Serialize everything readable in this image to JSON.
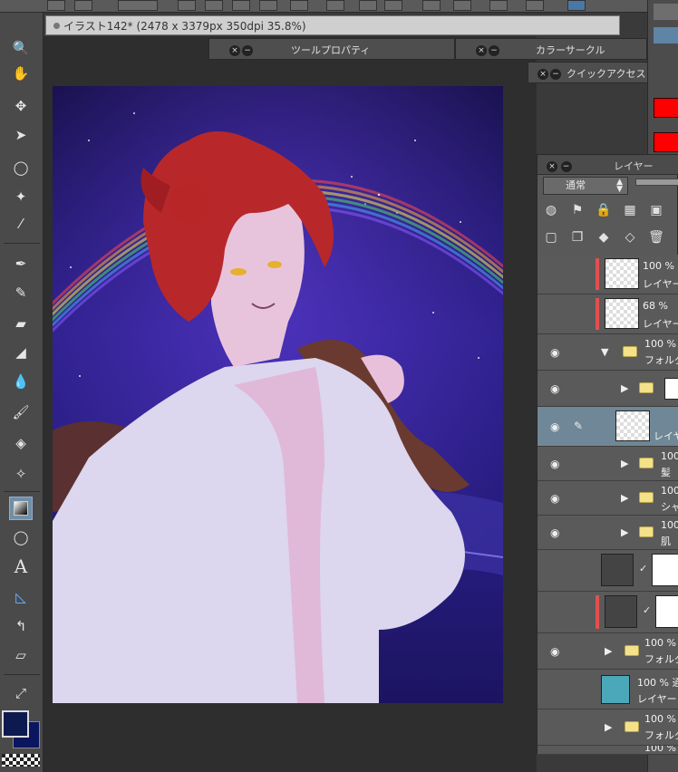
{
  "document": {
    "title": "イラスト142* (2478 x 3379px 350dpi 35.8%)"
  },
  "panels": {
    "tool_property": "ツールプロパティ",
    "color_circle": "カラーサークル",
    "quick_access": "クイックアクセス",
    "layer": "レイヤー"
  },
  "panel_buttons": {
    "close": "×",
    "minimize": "−"
  },
  "tools": [
    "zoom-tool",
    "hand-tool",
    "move-tool",
    "operation-tool",
    "lasso-tool",
    "magic-wand-tool",
    "eyedropper-tool",
    "pen-tool",
    "pencil-tool",
    "brush-tool",
    "eraser-tool",
    "blend-tool",
    "fill-tool",
    "gradient-tool",
    "figure-tool",
    "text-tool",
    "ruler-tool",
    "balloon-tool",
    "frame-tool",
    "correct-line-tool"
  ],
  "colors": {
    "main": "#0d1a50",
    "sub": "#0a1660",
    "accent": "#6f8fa6",
    "swatch_red": "#ff0000"
  },
  "layer_panel": {
    "blend_mode": "通常",
    "layers": [
      {
        "opacity": "100 %",
        "name": "レイヤー",
        "type": "raster",
        "visible": false,
        "red": true
      },
      {
        "opacity": "68 %",
        "name": "レイヤー",
        "type": "raster",
        "visible": false,
        "red": true
      },
      {
        "opacity": "100 %",
        "name": "フォルダー",
        "type": "folder",
        "visible": true,
        "expanded": true
      },
      {
        "opacity": "",
        "name": "",
        "type": "folder-sub",
        "visible": true
      },
      {
        "opacity": "",
        "name": "レイヤ",
        "type": "selected",
        "visible": true
      },
      {
        "opacity": "100",
        "name": "髪",
        "type": "folder-sub",
        "visible": true
      },
      {
        "opacity": "100",
        "name": "シャ",
        "type": "folder-sub",
        "visible": true
      },
      {
        "opacity": "100",
        "name": "肌",
        "type": "folder-sub",
        "visible": true
      },
      {
        "opacity": "",
        "name": "",
        "type": "mask",
        "visible": false
      },
      {
        "opacity": "",
        "name": "",
        "type": "mask",
        "visible": false,
        "red": true
      },
      {
        "opacity": "100 %",
        "name": "フォルダ",
        "type": "folder",
        "visible": true
      },
      {
        "opacity": "100 % 通",
        "name": "レイヤー",
        "type": "teal",
        "visible": false
      },
      {
        "opacity": "100 %",
        "name": "フォルダ",
        "type": "folder",
        "visible": false
      },
      {
        "opacity": "100 %",
        "name": "",
        "type": "folder",
        "visible": false
      }
    ]
  }
}
